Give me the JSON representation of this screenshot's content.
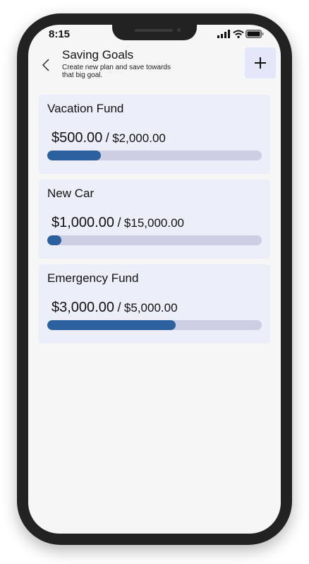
{
  "status_bar": {
    "time": "8:15"
  },
  "header": {
    "back_icon": "chevron-left-icon",
    "title": "Saving Goals",
    "subtitle": "Create new plan and save towards that big goal.",
    "add_icon": "plus-icon"
  },
  "goals": [
    {
      "name": "Vacation Fund",
      "saved": "$500.00",
      "separator": "/",
      "target": "$2,000.00",
      "progress": 0.25
    },
    {
      "name": "New Car",
      "saved": "$1,000.00",
      "separator": "/",
      "target": "$15,000.00",
      "progress": 0.0667
    },
    {
      "name": "Emergency Fund",
      "saved": "$3,000.00",
      "separator": "/",
      "target": "$5,000.00",
      "progress": 0.6
    }
  ],
  "colors": {
    "accent": "#2c609f",
    "track": "#cdcde4",
    "card_bg": "#eceff9",
    "add_button_bg": "#e4e6fa",
    "screen_bg": "#f6f6f6"
  }
}
